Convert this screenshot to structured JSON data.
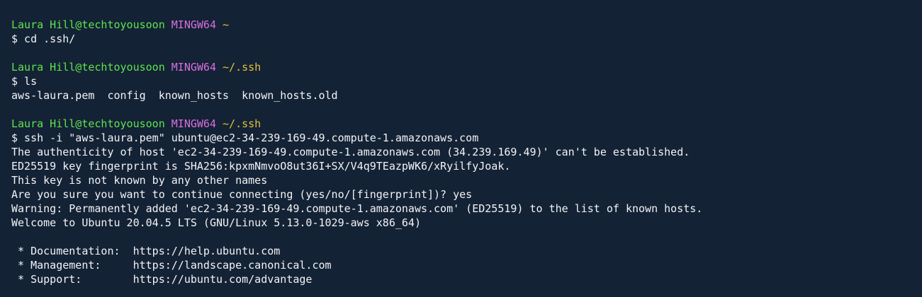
{
  "colors": {
    "background": "#142235",
    "text": "#f2f4f7",
    "user_host": "#5ee44f",
    "system": "#d86fe0",
    "path": "#e2c23e"
  },
  "lines": {
    "p1_user": "Laura Hill@techtoyousoon",
    "p1_sys": "MINGW64",
    "p1_path": "~",
    "cmd1": "$ cd .ssh/",
    "p2_user": "Laura Hill@techtoyousoon",
    "p2_sys": "MINGW64",
    "p2_path": "~/.ssh",
    "cmd2": "$ ls",
    "ls_out": "aws-laura.pem  config  known_hosts  known_hosts.old",
    "p3_user": "Laura Hill@techtoyousoon",
    "p3_sys": "MINGW64",
    "p3_path": "~/.ssh",
    "cmd3": "$ ssh -i \"aws-laura.pem\" ubuntu@ec2-34-239-169-49.compute-1.amazonaws.com",
    "out1": "The authenticity of host 'ec2-34-239-169-49.compute-1.amazonaws.com (34.239.169.49)' can't be established.",
    "out2": "ED25519 key fingerprint is SHA256:kpxmNmvoO8ut36I+SX/V4q9TEazpWK6/xRyilfyJoak.",
    "out3": "This key is not known by any other names",
    "out4": "Are you sure you want to continue connecting (yes/no/[fingerprint])? yes",
    "out5": "Warning: Permanently added 'ec2-34-239-169-49.compute-1.amazonaws.com' (ED25519) to the list of known hosts.",
    "out6": "Welcome to Ubuntu 20.04.5 LTS (GNU/Linux 5.13.0-1029-aws x86_64)",
    "doc": " * Documentation:  https://help.ubuntu.com",
    "mgmt": " * Management:     https://landscape.canonical.com",
    "support": " * Support:        https://ubuntu.com/advantage"
  }
}
